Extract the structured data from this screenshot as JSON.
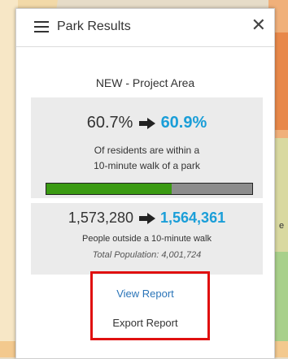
{
  "panel": {
    "title": "Park Results",
    "close_symbol": "✕",
    "scenario_label": "NEW - Project Area"
  },
  "walk_access": {
    "previous_pct": "60.7%",
    "new_pct": "60.9%",
    "description_line1": "Of residents are within a",
    "description_line2": "10-minute walk of a park",
    "progress_fraction": 0.609,
    "fill_color": "#3a9a12",
    "track_color": "#8c8c8c"
  },
  "outside_walk": {
    "previous_count": "1,573,280",
    "new_count": "1,564,361",
    "description": "People outside a 10-minute walk",
    "total_population": "Total Population: 4,001,724"
  },
  "actions": {
    "view_report": "View Report",
    "export_report": "Export Report"
  },
  "map_fragment_text": "e",
  "colors": {
    "accent": "#1a9ed8",
    "link": "#2a74b8",
    "highlight_box": "#e01010"
  },
  "icons": [
    "menu-icon",
    "close-icon",
    "arrow-right-icon"
  ]
}
